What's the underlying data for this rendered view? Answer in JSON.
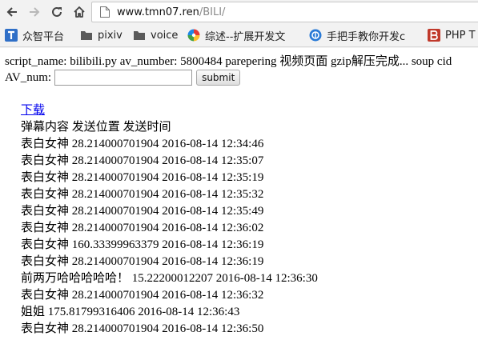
{
  "browser": {
    "address_host": "www.tmn07.ren",
    "address_path": "/BILI/",
    "bookmarks": [
      {
        "label": "众智平台",
        "icon": "t-square-icon"
      },
      {
        "label": "pixiv",
        "icon": "folder-icon"
      },
      {
        "label": "voice",
        "icon": "folder-icon"
      },
      {
        "label": "综述--扩展开发文",
        "icon": "pinwheel-icon"
      },
      {
        "label": "手把手教你开发c",
        "icon": "blue-circle-icon"
      },
      {
        "label": "PHP T",
        "icon": "b-logo-icon"
      }
    ]
  },
  "page": {
    "status_line": "script_name: bilibili.py av_number: 5800484 parepering 视频页面 gzip解压完成... soup cid",
    "form": {
      "label": "AV_num:",
      "input_value": "",
      "submit_label": "submit"
    },
    "download_link": "下载",
    "header": {
      "content": "弹幕内容",
      "position": "发送位置",
      "time": "发送时间"
    },
    "rows": [
      {
        "content": "表白女神",
        "position": "28.214000701904",
        "time": "2016-08-14 12:34:46"
      },
      {
        "content": "表白女神",
        "position": "28.214000701904",
        "time": "2016-08-14 12:35:07"
      },
      {
        "content": "表白女神",
        "position": "28.214000701904",
        "time": "2016-08-14 12:35:19"
      },
      {
        "content": "表白女神",
        "position": "28.214000701904",
        "time": "2016-08-14 12:35:32"
      },
      {
        "content": "表白女神",
        "position": "28.214000701904",
        "time": "2016-08-14 12:35:49"
      },
      {
        "content": "表白女神",
        "position": "28.214000701904",
        "time": "2016-08-14 12:36:02"
      },
      {
        "content": "表白女神",
        "position": "160.33399963379",
        "time": "2016-08-14 12:36:19"
      },
      {
        "content": "表白女神",
        "position": "28.214000701904",
        "time": "2016-08-14 12:36:19"
      },
      {
        "content": "前两万哈哈哈哈哈！",
        "position": "15.22200012207",
        "time": "2016-08-14 12:36:30"
      },
      {
        "content": "表白女神",
        "position": "28.214000701904",
        "time": "2016-08-14 12:36:32"
      },
      {
        "content": "姐姐",
        "position": "175.81799316406",
        "time": "2016-08-14 12:36:43"
      },
      {
        "content": "表白女神",
        "position": "28.214000701904",
        "time": "2016-08-14 12:36:50"
      }
    ]
  },
  "colors": {
    "link": "#0000ee",
    "chrome_bg": "#f2f2f2"
  }
}
